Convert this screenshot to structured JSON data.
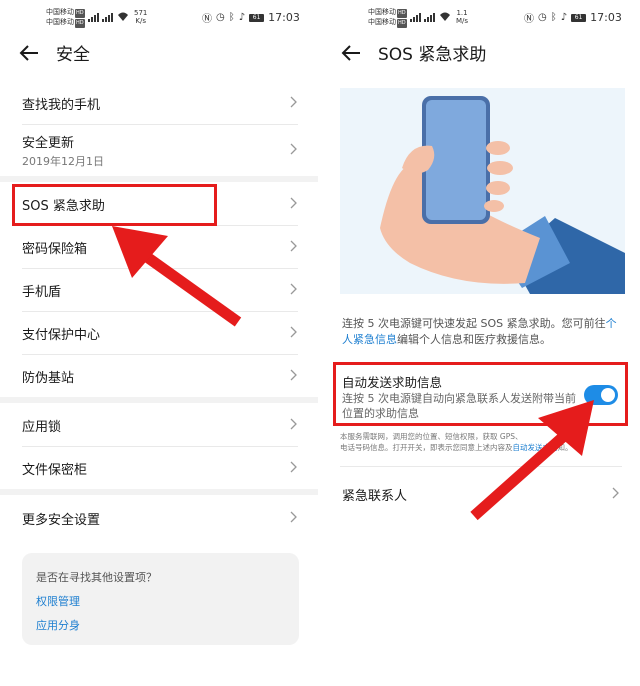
{
  "left": {
    "status": {
      "carrier1": "中国移动",
      "carrier2": "中国移动",
      "hd": "HD",
      "speed_value": "571",
      "speed_unit": "K/s",
      "time": "17:03",
      "battery": "61"
    },
    "title": "安全",
    "items": [
      {
        "label": "查找我的手机"
      },
      {
        "label": "安全更新",
        "sub": "2019年12月1日"
      },
      {
        "label": "SOS 紧急求助"
      },
      {
        "label": "密码保险箱"
      },
      {
        "label": "手机盾"
      },
      {
        "label": "支付保护中心"
      },
      {
        "label": "防伪基站"
      },
      {
        "label": "应用锁"
      },
      {
        "label": "文件保密柜"
      },
      {
        "label": "更多安全设置"
      }
    ],
    "hint": {
      "question": "是否在寻找其他设置项？",
      "links": [
        "权限管理",
        "应用分身"
      ]
    }
  },
  "right": {
    "status": {
      "carrier1": "中国移动",
      "carrier2": "中国移动",
      "hd": "HD",
      "speed_value": "1.1",
      "speed_unit": "M/s",
      "time": "17:03",
      "battery": "61"
    },
    "title": "SOS 紧急求助",
    "desc_text": "连按 5 次电源键可快速发起 SOS 紧急求助。您可前往",
    "desc_link": "个人紧急信息",
    "desc_tail": "编辑个人信息和医疗救援信息。",
    "auto_send": {
      "title": "自动发送求助信息",
      "subtitle": "连按 5 次电源键自动向紧急联系人发送附带当前位置的求助信息",
      "enabled": true
    },
    "fine_print_1": "本服务需联网，调用您的位置、短信权限，获取 GPS、",
    "fine_print_2": "电话号码信息。打开开关，即表示您同意上述内容及",
    "fine_print_link": "自动发送求助",
    "fine_print_tail": "知。",
    "contacts_label": "紧急联系人"
  },
  "colors": {
    "accent": "#1e8ce6",
    "link": "#1e7fd0",
    "annotation": "#e51c1c"
  }
}
